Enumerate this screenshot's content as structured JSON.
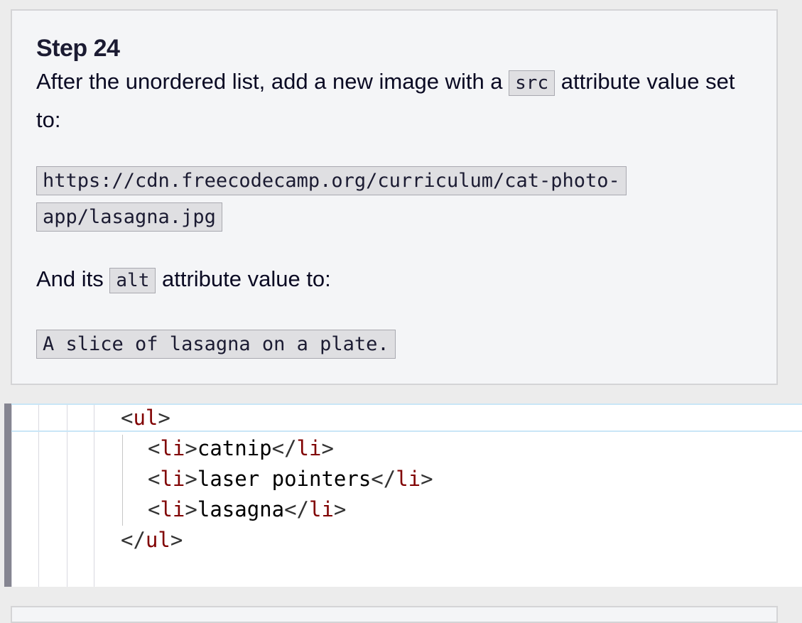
{
  "instructions": {
    "title": "Step 24",
    "para1_before": "After the unordered list, add a new image with a ",
    "para1_code": "src",
    "para1_after": " attribute value set to:",
    "url_code": "https://cdn.freecodecamp.org/curriculum/cat-photo-app/lasagna.jpg",
    "para2_before": "And its ",
    "para2_code": "alt",
    "para2_after": " attribute value to:",
    "alt_code": "A slice of lasagna on a plate."
  },
  "editor": {
    "lines": [
      {
        "indent": "ul",
        "open": "<",
        "tag": "ul",
        "close": ">",
        "text": "",
        "end_open": "",
        "end_tag": "",
        "end_close": ""
      },
      {
        "indent": "li",
        "open": "<",
        "tag": "li",
        "close": ">",
        "text": "catnip",
        "end_open": "</",
        "end_tag": "li",
        "end_close": ">"
      },
      {
        "indent": "li",
        "open": "<",
        "tag": "li",
        "close": ">",
        "text": "laser pointers",
        "end_open": "</",
        "end_tag": "li",
        "end_close": ">"
      },
      {
        "indent": "li",
        "open": "<",
        "tag": "li",
        "close": ">",
        "text": "lasagna",
        "end_open": "</",
        "end_tag": "li",
        "end_close": ">"
      },
      {
        "indent": "ul",
        "open": "</",
        "tag": "ul",
        "close": ">",
        "text": "",
        "end_open": "",
        "end_tag": "",
        "end_close": ""
      }
    ]
  },
  "colors": {
    "tag": "#800000",
    "accent_bar": "#858591",
    "active_line_border": "#c9e6f7"
  }
}
